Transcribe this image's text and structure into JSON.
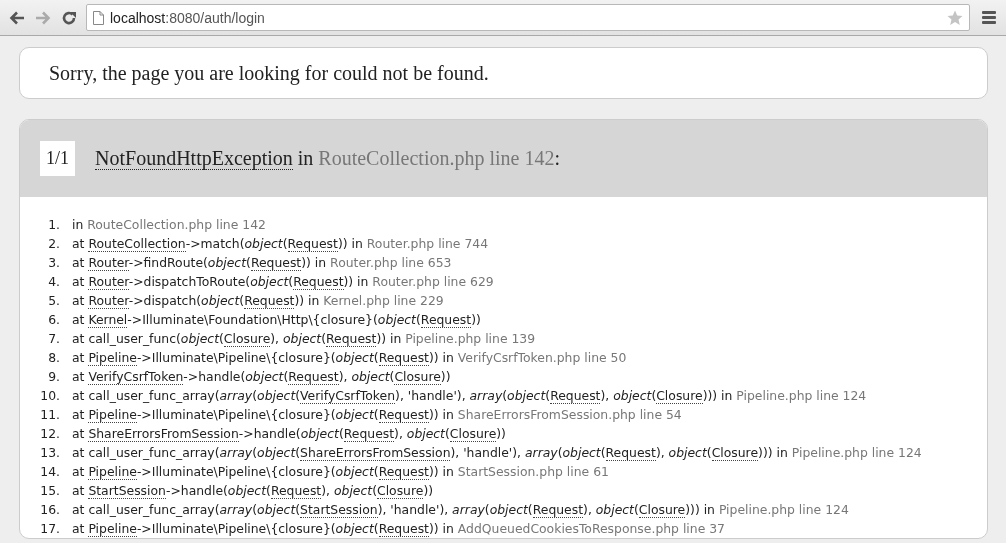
{
  "browser": {
    "address": {
      "host": "localhost",
      "rest": ":8080/auth/login"
    }
  },
  "message": "Sorry, the page you are looking for could not be found.",
  "exception": {
    "counter": "1/1",
    "name": "NotFoundHttpException",
    "in": "in",
    "file": "RouteCollection.php line 142",
    "colon": ":"
  },
  "trace": [
    {
      "number": "1.",
      "parts": [
        {
          "kind": "plain",
          "text": "in "
        },
        {
          "kind": "file",
          "text": "RouteCollection.php line 142"
        }
      ]
    },
    {
      "number": "2.",
      "parts": [
        {
          "kind": "plain",
          "text": "at "
        },
        {
          "kind": "class",
          "text": "RouteCollection"
        },
        {
          "kind": "plain",
          "text": "->match("
        },
        {
          "kind": "italic",
          "text": "object"
        },
        {
          "kind": "plain",
          "text": "("
        },
        {
          "kind": "class",
          "text": "Request"
        },
        {
          "kind": "plain",
          "text": ")) in "
        },
        {
          "kind": "file",
          "text": "Router.php line 744"
        }
      ]
    },
    {
      "number": "3.",
      "parts": [
        {
          "kind": "plain",
          "text": "at "
        },
        {
          "kind": "class",
          "text": "Router"
        },
        {
          "kind": "plain",
          "text": "->findRoute("
        },
        {
          "kind": "italic",
          "text": "object"
        },
        {
          "kind": "plain",
          "text": "("
        },
        {
          "kind": "class",
          "text": "Request"
        },
        {
          "kind": "plain",
          "text": ")) in "
        },
        {
          "kind": "file",
          "text": "Router.php line 653"
        }
      ]
    },
    {
      "number": "4.",
      "parts": [
        {
          "kind": "plain",
          "text": "at "
        },
        {
          "kind": "class",
          "text": "Router"
        },
        {
          "kind": "plain",
          "text": "->dispatchToRoute("
        },
        {
          "kind": "italic",
          "text": "object"
        },
        {
          "kind": "plain",
          "text": "("
        },
        {
          "kind": "class",
          "text": "Request"
        },
        {
          "kind": "plain",
          "text": ")) in "
        },
        {
          "kind": "file",
          "text": "Router.php line 629"
        }
      ]
    },
    {
      "number": "5.",
      "parts": [
        {
          "kind": "plain",
          "text": "at "
        },
        {
          "kind": "class",
          "text": "Router"
        },
        {
          "kind": "plain",
          "text": "->dispatch("
        },
        {
          "kind": "italic",
          "text": "object"
        },
        {
          "kind": "plain",
          "text": "("
        },
        {
          "kind": "class",
          "text": "Request"
        },
        {
          "kind": "plain",
          "text": ")) in "
        },
        {
          "kind": "file",
          "text": "Kernel.php line 229"
        }
      ]
    },
    {
      "number": "6.",
      "parts": [
        {
          "kind": "plain",
          "text": "at "
        },
        {
          "kind": "class",
          "text": "Kernel"
        },
        {
          "kind": "plain",
          "text": "->Illuminate\\Foundation\\Http\\{closure}("
        },
        {
          "kind": "italic",
          "text": "object"
        },
        {
          "kind": "plain",
          "text": "("
        },
        {
          "kind": "class",
          "text": "Request"
        },
        {
          "kind": "plain",
          "text": "))"
        }
      ]
    },
    {
      "number": "7.",
      "parts": [
        {
          "kind": "plain",
          "text": "at call_user_func("
        },
        {
          "kind": "italic",
          "text": "object"
        },
        {
          "kind": "plain",
          "text": "("
        },
        {
          "kind": "class",
          "text": "Closure"
        },
        {
          "kind": "plain",
          "text": "), "
        },
        {
          "kind": "italic",
          "text": "object"
        },
        {
          "kind": "plain",
          "text": "("
        },
        {
          "kind": "class",
          "text": "Request"
        },
        {
          "kind": "plain",
          "text": ")) in "
        },
        {
          "kind": "file",
          "text": "Pipeline.php line 139"
        }
      ]
    },
    {
      "number": "8.",
      "parts": [
        {
          "kind": "plain",
          "text": "at "
        },
        {
          "kind": "class",
          "text": "Pipeline"
        },
        {
          "kind": "plain",
          "text": "->Illuminate\\Pipeline\\{closure}("
        },
        {
          "kind": "italic",
          "text": "object"
        },
        {
          "kind": "plain",
          "text": "("
        },
        {
          "kind": "class",
          "text": "Request"
        },
        {
          "kind": "plain",
          "text": ")) in "
        },
        {
          "kind": "file",
          "text": "VerifyCsrfToken.php line 50"
        }
      ]
    },
    {
      "number": "9.",
      "parts": [
        {
          "kind": "plain",
          "text": "at "
        },
        {
          "kind": "class",
          "text": "VerifyCsrfToken"
        },
        {
          "kind": "plain",
          "text": "->handle("
        },
        {
          "kind": "italic",
          "text": "object"
        },
        {
          "kind": "plain",
          "text": "("
        },
        {
          "kind": "class",
          "text": "Request"
        },
        {
          "kind": "plain",
          "text": "), "
        },
        {
          "kind": "italic",
          "text": "object"
        },
        {
          "kind": "plain",
          "text": "("
        },
        {
          "kind": "class",
          "text": "Closure"
        },
        {
          "kind": "plain",
          "text": "))"
        }
      ]
    },
    {
      "number": "10.",
      "parts": [
        {
          "kind": "plain",
          "text": "at call_user_func_array("
        },
        {
          "kind": "italic",
          "text": "array"
        },
        {
          "kind": "plain",
          "text": "("
        },
        {
          "kind": "italic",
          "text": "object"
        },
        {
          "kind": "plain",
          "text": "("
        },
        {
          "kind": "class",
          "text": "VerifyCsrfToken"
        },
        {
          "kind": "plain",
          "text": "), 'handle'), "
        },
        {
          "kind": "italic",
          "text": "array"
        },
        {
          "kind": "plain",
          "text": "("
        },
        {
          "kind": "italic",
          "text": "object"
        },
        {
          "kind": "plain",
          "text": "("
        },
        {
          "kind": "class",
          "text": "Request"
        },
        {
          "kind": "plain",
          "text": "), "
        },
        {
          "kind": "italic",
          "text": "object"
        },
        {
          "kind": "plain",
          "text": "("
        },
        {
          "kind": "class",
          "text": "Closure"
        },
        {
          "kind": "plain",
          "text": "))) in "
        },
        {
          "kind": "file",
          "text": "Pipeline.php line 124"
        }
      ]
    },
    {
      "number": "11.",
      "parts": [
        {
          "kind": "plain",
          "text": "at "
        },
        {
          "kind": "class",
          "text": "Pipeline"
        },
        {
          "kind": "plain",
          "text": "->Illuminate\\Pipeline\\{closure}("
        },
        {
          "kind": "italic",
          "text": "object"
        },
        {
          "kind": "plain",
          "text": "("
        },
        {
          "kind": "class",
          "text": "Request"
        },
        {
          "kind": "plain",
          "text": ")) in "
        },
        {
          "kind": "file",
          "text": "ShareErrorsFromSession.php line 54"
        }
      ]
    },
    {
      "number": "12.",
      "parts": [
        {
          "kind": "plain",
          "text": "at "
        },
        {
          "kind": "class",
          "text": "ShareErrorsFromSession"
        },
        {
          "kind": "plain",
          "text": "->handle("
        },
        {
          "kind": "italic",
          "text": "object"
        },
        {
          "kind": "plain",
          "text": "("
        },
        {
          "kind": "class",
          "text": "Request"
        },
        {
          "kind": "plain",
          "text": "), "
        },
        {
          "kind": "italic",
          "text": "object"
        },
        {
          "kind": "plain",
          "text": "("
        },
        {
          "kind": "class",
          "text": "Closure"
        },
        {
          "kind": "plain",
          "text": "))"
        }
      ]
    },
    {
      "number": "13.",
      "parts": [
        {
          "kind": "plain",
          "text": "at call_user_func_array("
        },
        {
          "kind": "italic",
          "text": "array"
        },
        {
          "kind": "plain",
          "text": "("
        },
        {
          "kind": "italic",
          "text": "object"
        },
        {
          "kind": "plain",
          "text": "("
        },
        {
          "kind": "class",
          "text": "ShareErrorsFromSession"
        },
        {
          "kind": "plain",
          "text": "), 'handle'), "
        },
        {
          "kind": "italic",
          "text": "array"
        },
        {
          "kind": "plain",
          "text": "("
        },
        {
          "kind": "italic",
          "text": "object"
        },
        {
          "kind": "plain",
          "text": "("
        },
        {
          "kind": "class",
          "text": "Request"
        },
        {
          "kind": "plain",
          "text": "), "
        },
        {
          "kind": "italic",
          "text": "object"
        },
        {
          "kind": "plain",
          "text": "("
        },
        {
          "kind": "class",
          "text": "Closure"
        },
        {
          "kind": "plain",
          "text": "))) in "
        },
        {
          "kind": "file",
          "text": "Pipeline.php line 124"
        }
      ]
    },
    {
      "number": "14.",
      "parts": [
        {
          "kind": "plain",
          "text": "at "
        },
        {
          "kind": "class",
          "text": "Pipeline"
        },
        {
          "kind": "plain",
          "text": "->Illuminate\\Pipeline\\{closure}("
        },
        {
          "kind": "italic",
          "text": "object"
        },
        {
          "kind": "plain",
          "text": "("
        },
        {
          "kind": "class",
          "text": "Request"
        },
        {
          "kind": "plain",
          "text": ")) in "
        },
        {
          "kind": "file",
          "text": "StartSession.php line 61"
        }
      ]
    },
    {
      "number": "15.",
      "parts": [
        {
          "kind": "plain",
          "text": "at "
        },
        {
          "kind": "class",
          "text": "StartSession"
        },
        {
          "kind": "plain",
          "text": "->handle("
        },
        {
          "kind": "italic",
          "text": "object"
        },
        {
          "kind": "plain",
          "text": "("
        },
        {
          "kind": "class",
          "text": "Request"
        },
        {
          "kind": "plain",
          "text": "), "
        },
        {
          "kind": "italic",
          "text": "object"
        },
        {
          "kind": "plain",
          "text": "("
        },
        {
          "kind": "class",
          "text": "Closure"
        },
        {
          "kind": "plain",
          "text": "))"
        }
      ]
    },
    {
      "number": "16.",
      "parts": [
        {
          "kind": "plain",
          "text": "at call_user_func_array("
        },
        {
          "kind": "italic",
          "text": "array"
        },
        {
          "kind": "plain",
          "text": "("
        },
        {
          "kind": "italic",
          "text": "object"
        },
        {
          "kind": "plain",
          "text": "("
        },
        {
          "kind": "class",
          "text": "StartSession"
        },
        {
          "kind": "plain",
          "text": "), 'handle'), "
        },
        {
          "kind": "italic",
          "text": "array"
        },
        {
          "kind": "plain",
          "text": "("
        },
        {
          "kind": "italic",
          "text": "object"
        },
        {
          "kind": "plain",
          "text": "("
        },
        {
          "kind": "class",
          "text": "Request"
        },
        {
          "kind": "plain",
          "text": "), "
        },
        {
          "kind": "italic",
          "text": "object"
        },
        {
          "kind": "plain",
          "text": "("
        },
        {
          "kind": "class",
          "text": "Closure"
        },
        {
          "kind": "plain",
          "text": "))) in "
        },
        {
          "kind": "file",
          "text": "Pipeline.php line 124"
        }
      ]
    },
    {
      "number": "17.",
      "parts": [
        {
          "kind": "plain",
          "text": "at "
        },
        {
          "kind": "class",
          "text": "Pipeline"
        },
        {
          "kind": "plain",
          "text": "->Illuminate\\Pipeline\\{closure}("
        },
        {
          "kind": "italic",
          "text": "object"
        },
        {
          "kind": "plain",
          "text": "("
        },
        {
          "kind": "class",
          "text": "Request"
        },
        {
          "kind": "plain",
          "text": ")) in "
        },
        {
          "kind": "file",
          "text": "AddQueuedCookiesToResponse.php line 37"
        }
      ]
    }
  ]
}
